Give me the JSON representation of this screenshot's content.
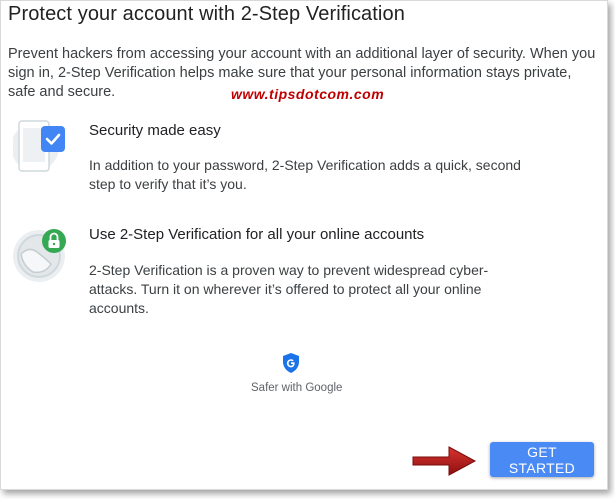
{
  "page": {
    "title": "Protect your account with 2-Step Verification",
    "intro": "Prevent hackers from accessing your account with an additional layer of security. When you sign in, 2-Step Verification helps make sure that your personal information stays private, safe and secure."
  },
  "watermark": "www.tipsdotcom.com",
  "features": [
    {
      "title": "Security made easy",
      "description": "In addition to your password, 2-Step Verification adds a quick, second step to verify that it’s you.",
      "icon": "phone-check-icon"
    },
    {
      "title": "Use 2-Step Verification for all your online accounts",
      "description": "2-Step Verification is a proven way to prevent widespread cyber-attacks. Turn it on wherever it’s offered to protect all your online accounts.",
      "icon": "globe-lock-icon"
    }
  ],
  "brand": {
    "text": "Safer with Google",
    "icon": "google-shield-icon"
  },
  "actions": {
    "primary_label": "GET STARTED"
  },
  "colors": {
    "primary_button": "#4a8af4",
    "watermark": "#c00000",
    "arrow": "#b01818",
    "security_green": "#34a853",
    "check_blue": "#4285f4"
  }
}
